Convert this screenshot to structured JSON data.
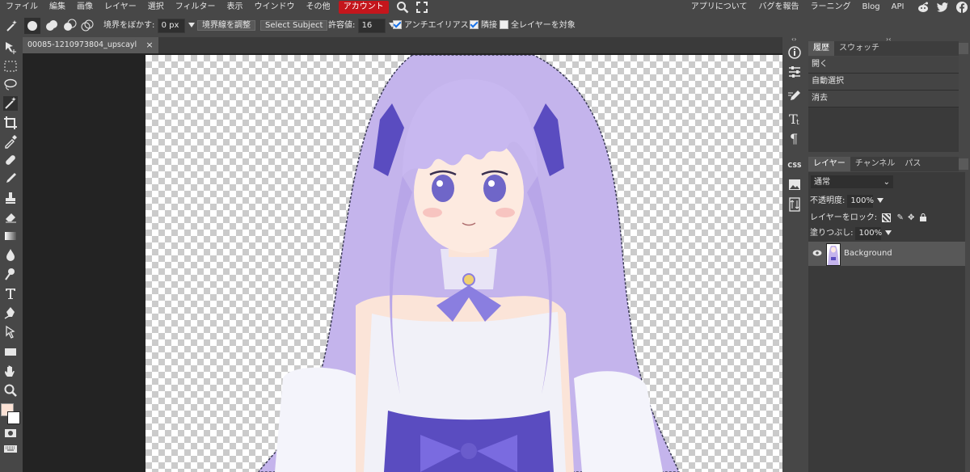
{
  "menubar": {
    "items": [
      "ファイル",
      "編集",
      "画像",
      "レイヤー",
      "選択",
      "フィルター",
      "表示",
      "ウインドウ",
      "その他"
    ],
    "account": "アカウント",
    "right_links": [
      "アプリについて",
      "バグを報告",
      "ラーニング",
      "Blog",
      "API"
    ]
  },
  "options": {
    "feather_label": "境界をぼかす:",
    "feather_value": "0 px",
    "refine_edge": "境界線を調整",
    "select_subject": "Select Subject",
    "tolerance_label": "許容値:",
    "tolerance_value": "16",
    "antialias_label": "アンチエイリアス",
    "contiguous_label": "隣接",
    "all_layers_label": "全レイヤーを対象",
    "antialias_checked": true,
    "contiguous_checked": true,
    "all_layers_checked": false
  },
  "document": {
    "tab_title": "00085-1210973804_upscayl",
    "modified_mark": "*",
    "close_glyph": "×"
  },
  "history_panel": {
    "tabs": [
      "履歴",
      "スウォッチ"
    ],
    "items": [
      "開く",
      "自動選択",
      "消去"
    ]
  },
  "layers_panel": {
    "tabs": [
      "レイヤー",
      "チャンネル",
      "パス"
    ],
    "blend_mode": "通常",
    "opacity_label": "不透明度:",
    "opacity_value": "100%",
    "lock_label": "レイヤーをロック:",
    "fill_label": "塗りつぶし:",
    "fill_value": "100%",
    "layers": [
      {
        "name": "Background"
      }
    ]
  },
  "side_icons": {
    "css": "CSS"
  },
  "colors": {
    "foreground": "#fde3d6",
    "background": "#ffffff",
    "account": "#c4161c",
    "hair": "#b9a8e6",
    "dress_accent": "#6a5ccc"
  }
}
